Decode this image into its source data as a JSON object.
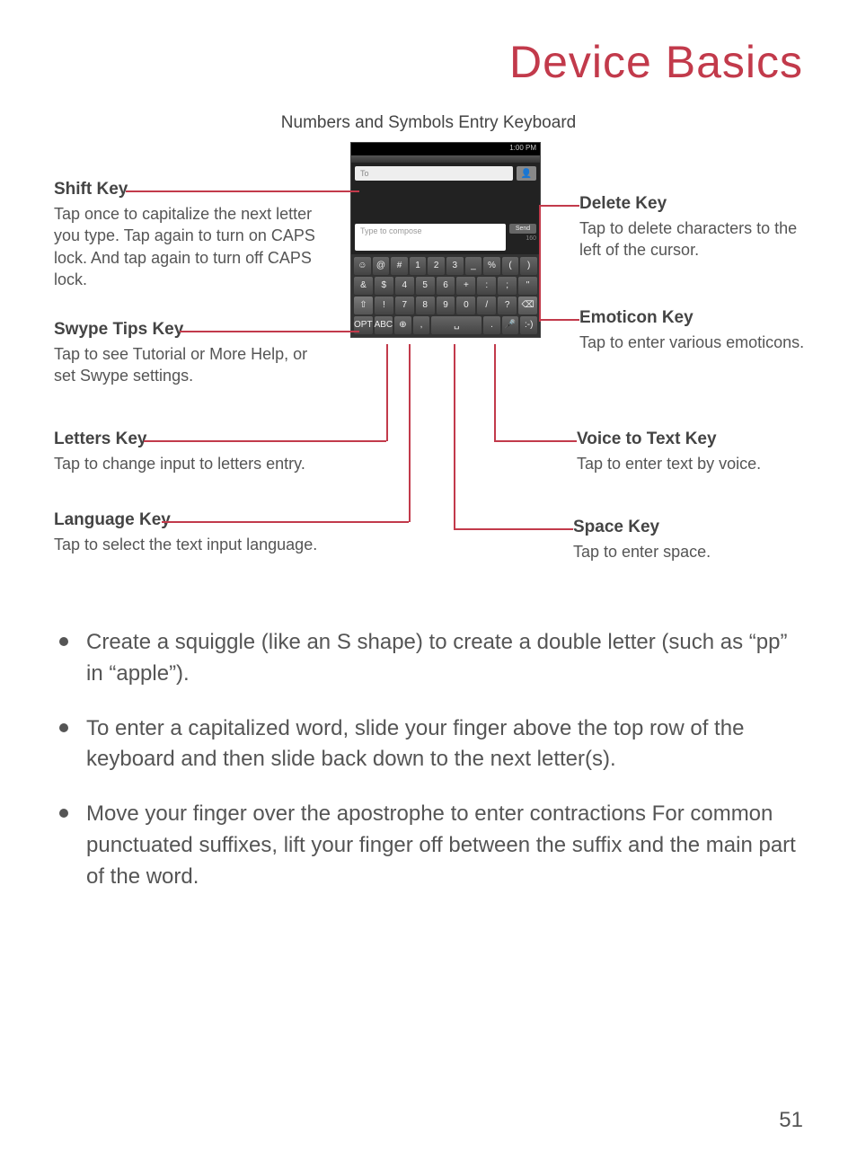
{
  "header": {
    "title": "Device Basics"
  },
  "diagram": {
    "caption": "Numbers and Symbols Entry Keyboard",
    "phone": {
      "status_time": "1:00 PM",
      "to_placeholder": "To",
      "compose_placeholder": "Type to compose",
      "send_label": "Send",
      "counter": "160"
    },
    "keyboard": {
      "row1": [
        "☺",
        "@",
        "#",
        "1",
        "2",
        "3",
        "_",
        "%",
        "(",
        ")"
      ],
      "row2": [
        "&",
        "$",
        "4",
        "5",
        "6",
        "+",
        ":",
        ";",
        "\""
      ],
      "row3": [
        "⇧",
        "!",
        "7",
        "8",
        "9",
        "0",
        "/",
        "?",
        "⌫"
      ],
      "row4": [
        "OPT",
        "ABC",
        "⊕",
        ",",
        "␣",
        ".",
        "🎤",
        ":-)"
      ]
    },
    "callouts": {
      "shift": {
        "title": "Shift Key",
        "desc": "Tap once to capitalize the next letter you type. Tap again to turn on CAPS lock. And tap again to turn off CAPS lock."
      },
      "swype": {
        "title": "Swype Tips Key",
        "desc": "Tap to see Tutorial or More Help, or set Swype settings."
      },
      "letters": {
        "title": "Letters Key",
        "desc": "Tap to change input to letters entry."
      },
      "language": {
        "title": "Language Key",
        "desc": "Tap to select the text input language."
      },
      "delete": {
        "title": "Delete Key",
        "desc": "Tap to delete characters to the left of the cursor."
      },
      "emoticon": {
        "title": "Emoticon Key",
        "desc": "Tap to enter various emoticons."
      },
      "voice": {
        "title": "Voice to Text Key",
        "desc": "Tap to enter text by voice."
      },
      "space": {
        "title": "Space Key",
        "desc": "Tap to enter space."
      }
    }
  },
  "tips": [
    "Create a squiggle (like an S shape) to create a double letter (such as “pp” in “apple”).",
    "To enter a capitalized word, slide your finger above the top row of the keyboard and then slide back down to the next letter(s).",
    "Move your finger over the apostrophe to enter contractions For common punctuated suffixes, lift your finger off between the suffix and the main part of the word."
  ],
  "page_number": "51"
}
